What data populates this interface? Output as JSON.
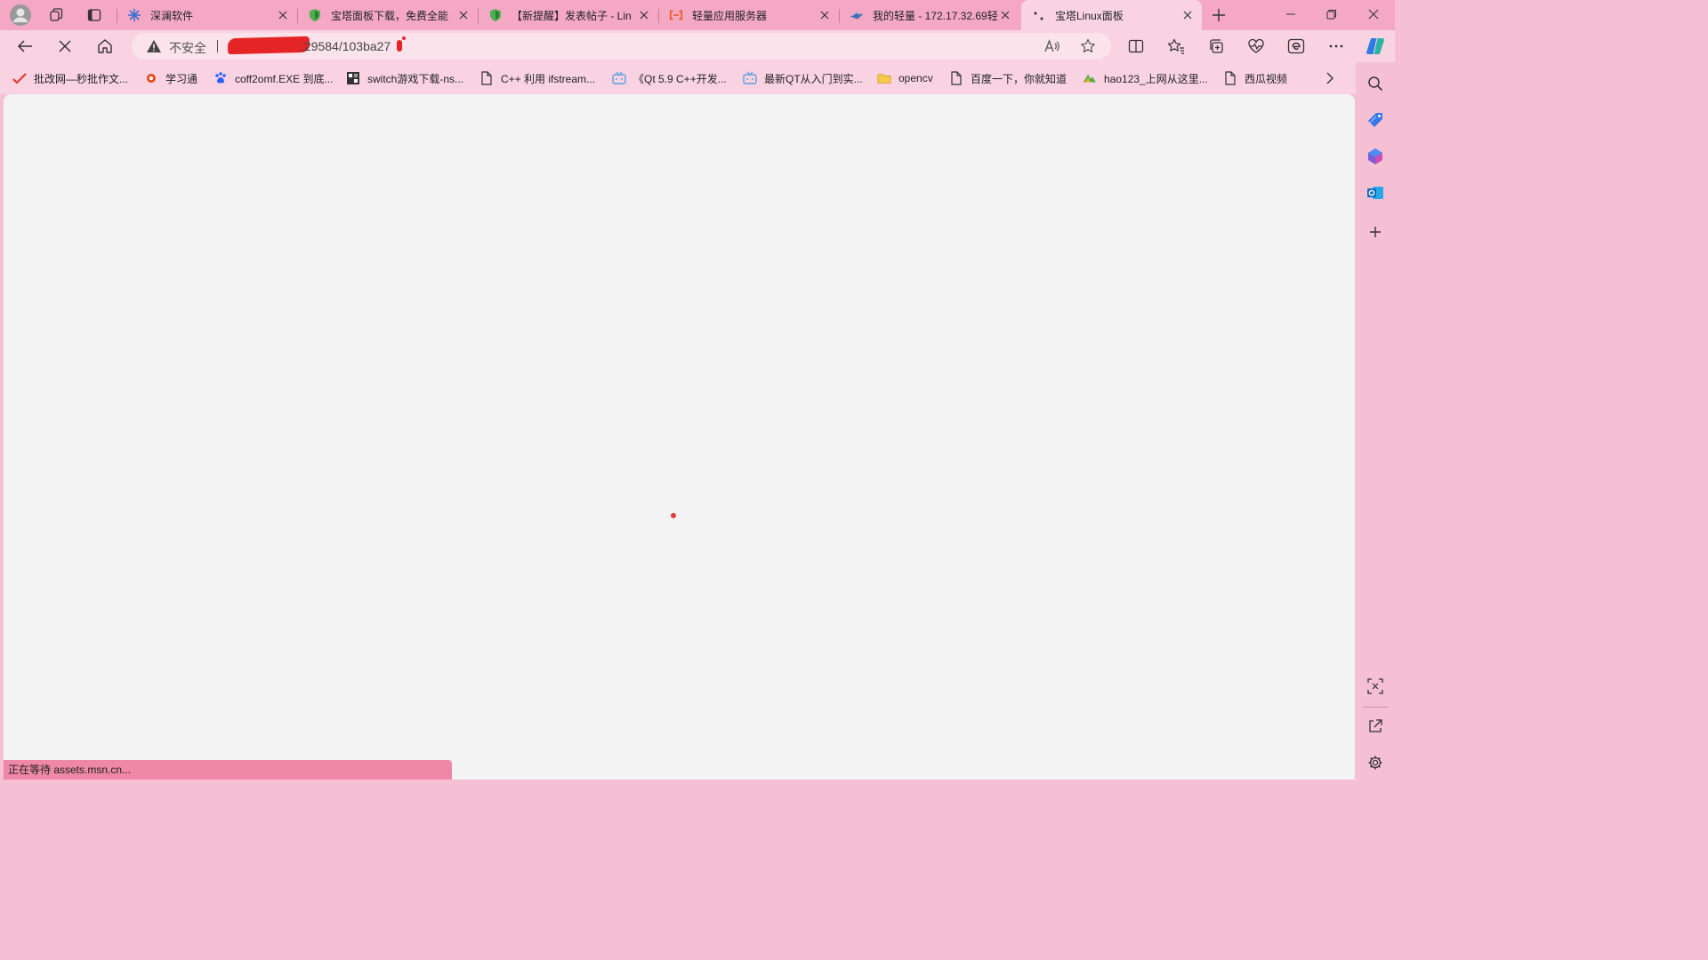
{
  "tabs": [
    {
      "title": "深澜软件",
      "active": false,
      "favicon": "snowflake-icon"
    },
    {
      "title": "宝塔面板下载，免费全能",
      "active": false,
      "favicon": "shield-icon"
    },
    {
      "title": "【新提醒】发表帖子 - Lin",
      "active": false,
      "favicon": "shield-icon"
    },
    {
      "title": "轻量应用服务器",
      "active": false,
      "favicon": "cloud-bracket-icon"
    },
    {
      "title": "我的轻量 - 172.17.32.69轻",
      "active": false,
      "favicon": "server-icon"
    },
    {
      "title": "宝塔Linux面板",
      "active": true,
      "favicon": "loading-dots-icon"
    }
  ],
  "address_bar": {
    "security_label": "不安全",
    "url": ":29584/103ba27"
  },
  "bookmarks": [
    {
      "label": "批改网—秒批作文...",
      "icon": "check-icon"
    },
    {
      "label": "学习通",
      "icon": "circle-logo-icon"
    },
    {
      "label": "coff2omf.EXE 到底...",
      "icon": "paw-icon"
    },
    {
      "label": "switch游戏下载-ns...",
      "icon": "grid-logo-icon"
    },
    {
      "label": "C++ 利用 ifstream...",
      "icon": "page-icon"
    },
    {
      "label": "《Qt 5.9 C++开发...",
      "icon": "tv-icon"
    },
    {
      "label": "最新QT从入门到实...",
      "icon": "tv-icon"
    },
    {
      "label": "opencv",
      "icon": "folder-icon"
    },
    {
      "label": "百度一下，你就知道",
      "icon": "page-icon"
    },
    {
      "label": "hao123_上网从这里...",
      "icon": "hao-icon"
    },
    {
      "label": "西瓜视频",
      "icon": "page-icon"
    }
  ],
  "status_bar": {
    "text": "正在等待 assets.msn.cn..."
  },
  "colors": {
    "tabbar": "#f4a8c3",
    "toolbar": "#f9d3e1",
    "content": "#f3f3f3",
    "status": "#ee87a8",
    "loader": "#e53a3a"
  }
}
